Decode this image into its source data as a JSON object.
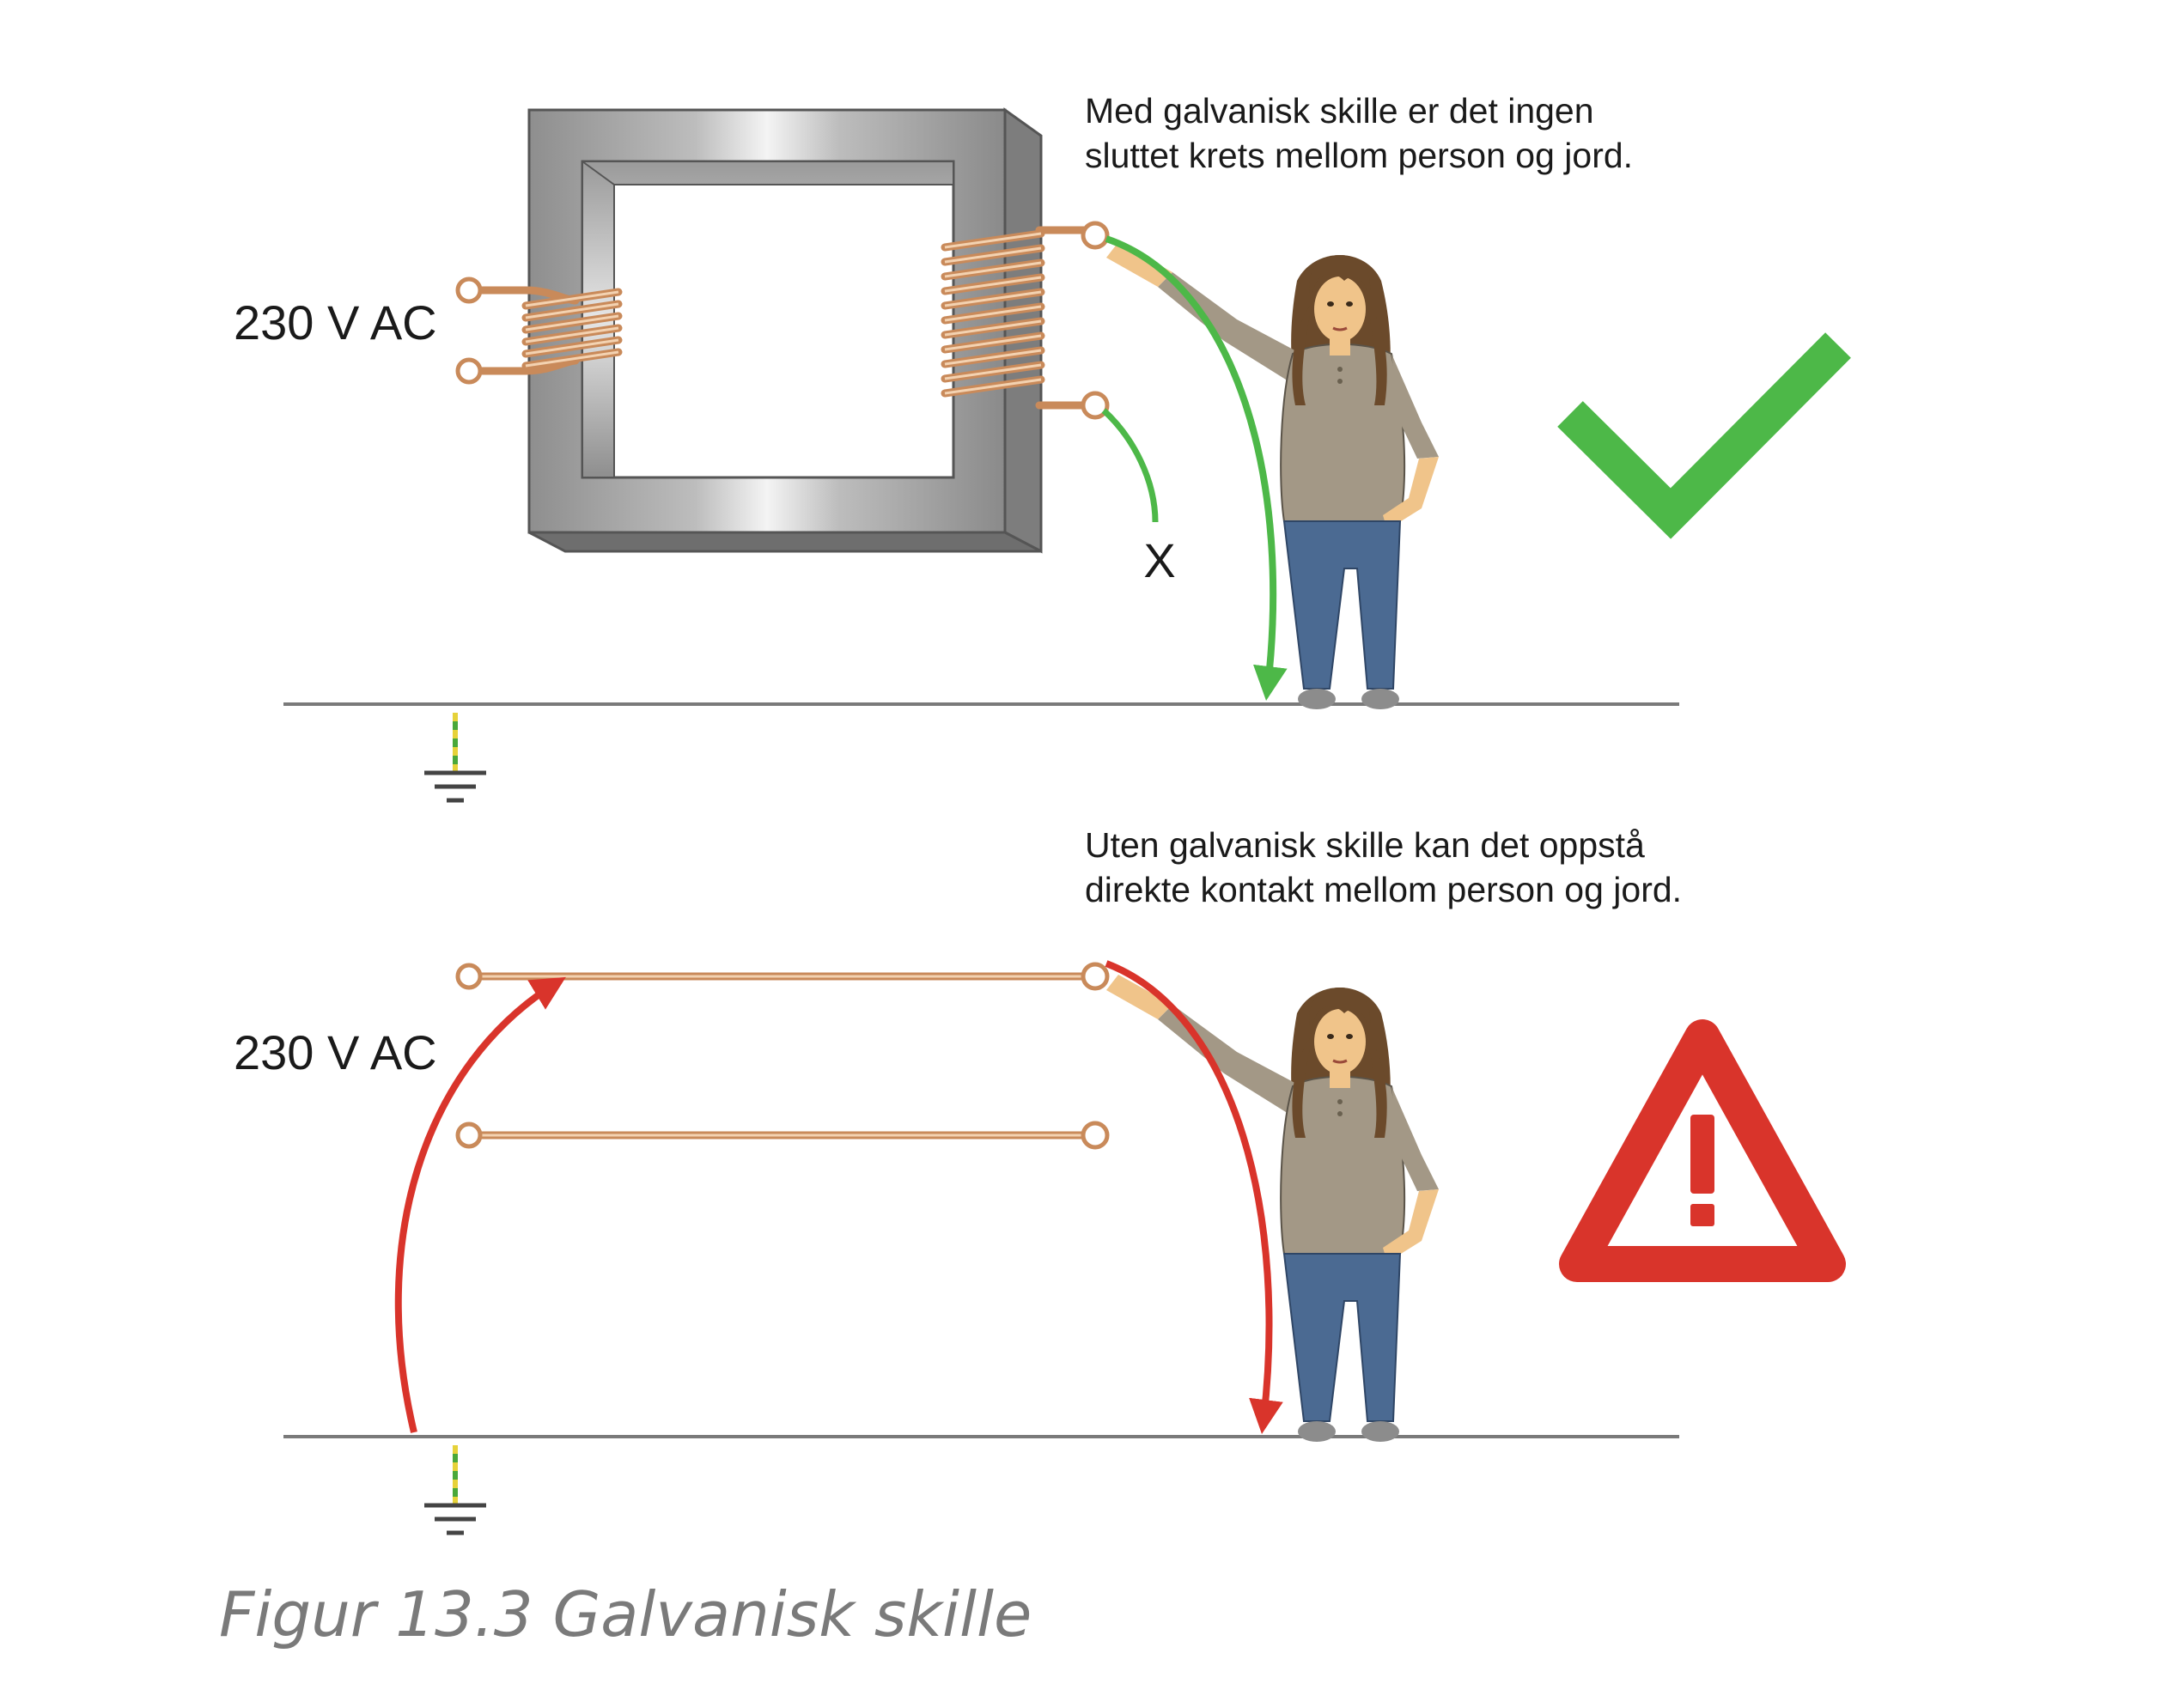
{
  "top": {
    "voltage_label": "230 V AC",
    "caption_line1": "Med galvanisk skille er det ingen",
    "caption_line2": "sluttet krets mellom person og jord.",
    "open_end_label": "X"
  },
  "bottom": {
    "voltage_label": "230 V AC",
    "caption_line1": "Uten galvanisk skille kan det oppstå",
    "caption_line2": "direkte kontakt mellom person og jord."
  },
  "figure_caption": "Figur 13.3 Galvanisk skille",
  "icons": {
    "ok": "checkmark-icon",
    "warning": "warning-triangle-icon"
  },
  "colors": {
    "ok_green": "#4db848",
    "danger_red": "#d9342b",
    "copper": "#d9a276",
    "core_gray": "#a9a9a9",
    "ground_line": "#7a7a7a"
  }
}
